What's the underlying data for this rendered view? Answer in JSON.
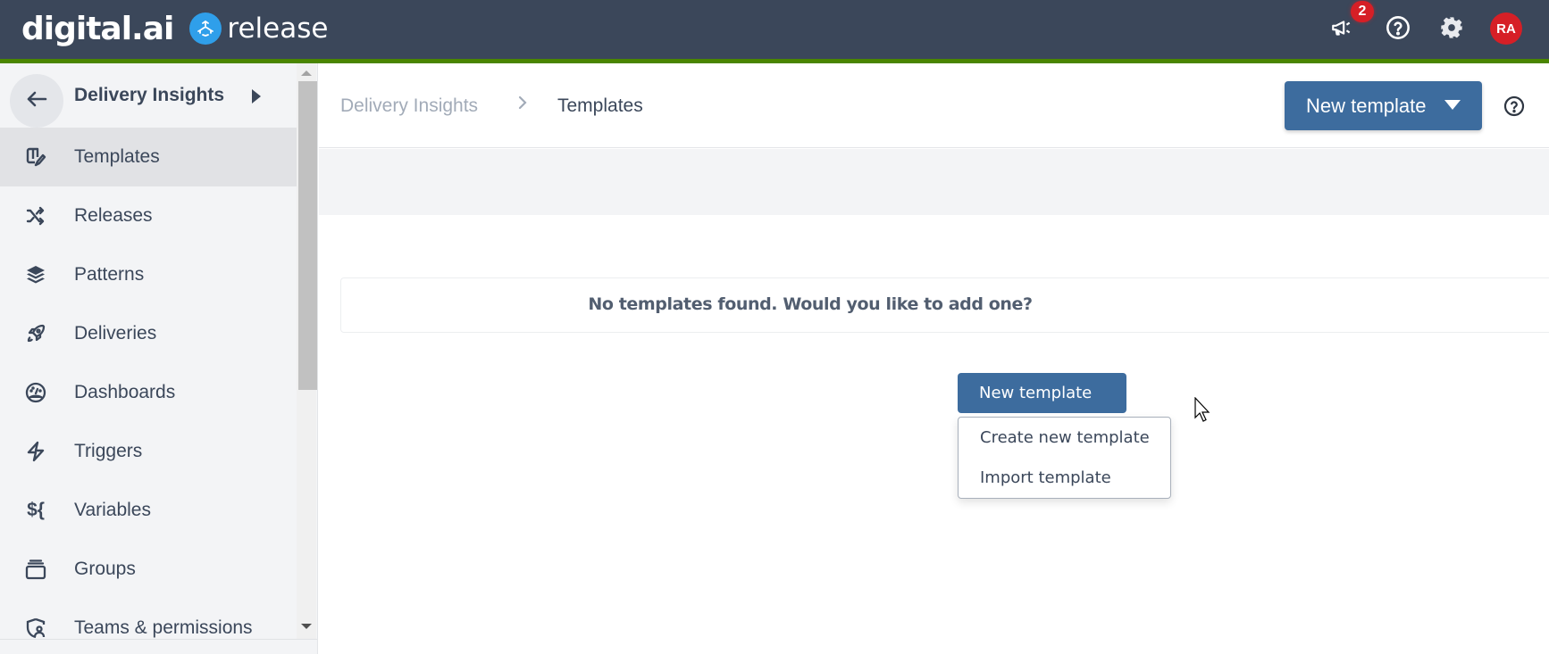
{
  "topbar": {
    "brand": "digital.ai",
    "product": "release",
    "notifications_count": "2",
    "notifications_icon": "megaphone-icon",
    "help_icon": "help-circle-icon",
    "settings_icon": "gear-icon",
    "user_initials": "RA",
    "accent_color": "#4a8500",
    "avatar_color": "#d61f26"
  },
  "sidebar": {
    "title": "Delivery Insights",
    "back_icon": "arrow-left-icon",
    "expand_icon": "caret-right-icon",
    "items": [
      {
        "label": "Templates",
        "icon": "templates-icon",
        "active": true
      },
      {
        "label": "Releases",
        "icon": "shuffle-icon",
        "active": false
      },
      {
        "label": "Patterns",
        "icon": "layers-icon",
        "active": false
      },
      {
        "label": "Deliveries",
        "icon": "rocket-icon",
        "active": false
      },
      {
        "label": "Dashboards",
        "icon": "gauge-icon",
        "active": false
      },
      {
        "label": "Triggers",
        "icon": "bolt-icon",
        "active": false
      },
      {
        "label": "Variables",
        "icon": "variables-icon",
        "active": false,
        "glyph": "${"
      },
      {
        "label": "Groups",
        "icon": "groups-icon",
        "active": false
      },
      {
        "label": "Teams & permissions",
        "icon": "shield-user-icon",
        "active": false
      }
    ]
  },
  "main": {
    "breadcrumb": [
      "Delivery Insights",
      "Templates"
    ],
    "breadcrumb_separator": ">",
    "new_template_label": "New template",
    "empty_message": "No templates found. Would you like to add one?",
    "center_button_label": "New template",
    "dropdown_items": [
      "Create new template",
      "Import template"
    ],
    "primary_color": "#3d6c9e"
  }
}
